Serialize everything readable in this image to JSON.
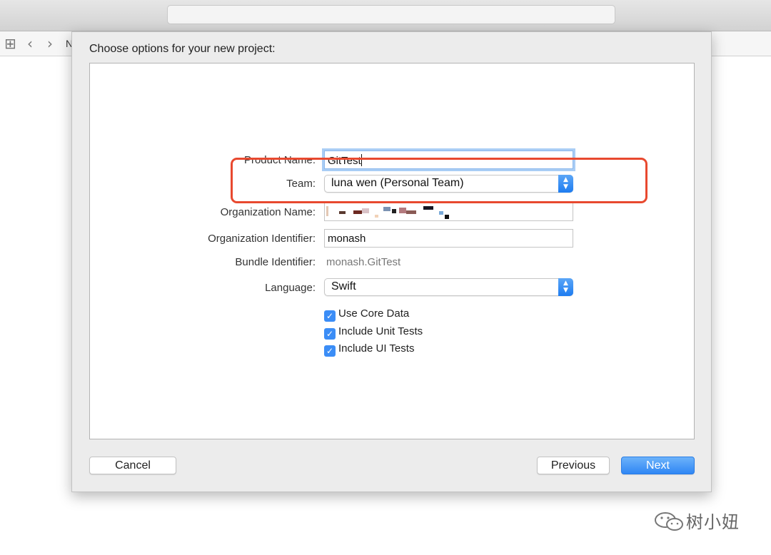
{
  "window": {
    "crumb": "N"
  },
  "sheet": {
    "title": "Choose options for your new project:",
    "fields": {
      "product_name": {
        "label": "Product Name:",
        "value": "GitTest"
      },
      "team": {
        "label": "Team:",
        "value": "luna wen (Personal Team)"
      },
      "organization_name": {
        "label": "Organization Name:"
      },
      "organization_identifier": {
        "label": "Organization Identifier:",
        "value": "monash"
      },
      "bundle_identifier": {
        "label": "Bundle Identifier:",
        "value": "monash.GitTest"
      },
      "language": {
        "label": "Language:",
        "value": "Swift"
      }
    },
    "checkboxes": [
      {
        "label": "Use Core Data",
        "checked": true
      },
      {
        "label": "Include Unit Tests",
        "checked": true
      },
      {
        "label": "Include UI Tests",
        "checked": true
      }
    ],
    "buttons": {
      "cancel": "Cancel",
      "previous": "Previous",
      "next": "Next"
    }
  },
  "colors": {
    "accent": "#2f86f4",
    "highlight": "#e8492f"
  },
  "watermark": "树小妞"
}
